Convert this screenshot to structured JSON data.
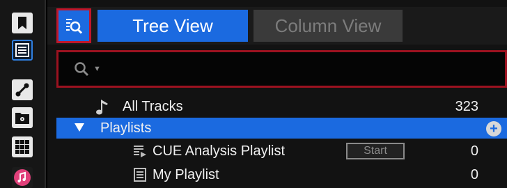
{
  "left_bar": {
    "buttons": [
      {
        "icon": "bookmark-icon"
      },
      {
        "icon": "browser-list-icon",
        "active": true
      },
      {
        "icon": "link-icon"
      },
      {
        "icon": "explorer-icon"
      },
      {
        "icon": "grid-icon"
      },
      {
        "icon": "music-icon"
      }
    ]
  },
  "tabs": {
    "items": [
      {
        "label": "Tree View",
        "active": true
      },
      {
        "label": "Column View",
        "active": false
      }
    ]
  },
  "search": {
    "placeholder": "",
    "value": ""
  },
  "tree": {
    "all_tracks": {
      "label": "All Tracks",
      "count": "323"
    },
    "playlists": {
      "label": "Playlists",
      "expanded": true,
      "add_symbol": "+"
    },
    "children": [
      {
        "label": "CUE Analysis Playlist",
        "count": "0",
        "action_label": "Start"
      },
      {
        "label": "My Playlist",
        "count": "0"
      }
    ]
  },
  "colors": {
    "accent_blue": "#1b6ae0",
    "highlight_red": "#c0162a"
  }
}
